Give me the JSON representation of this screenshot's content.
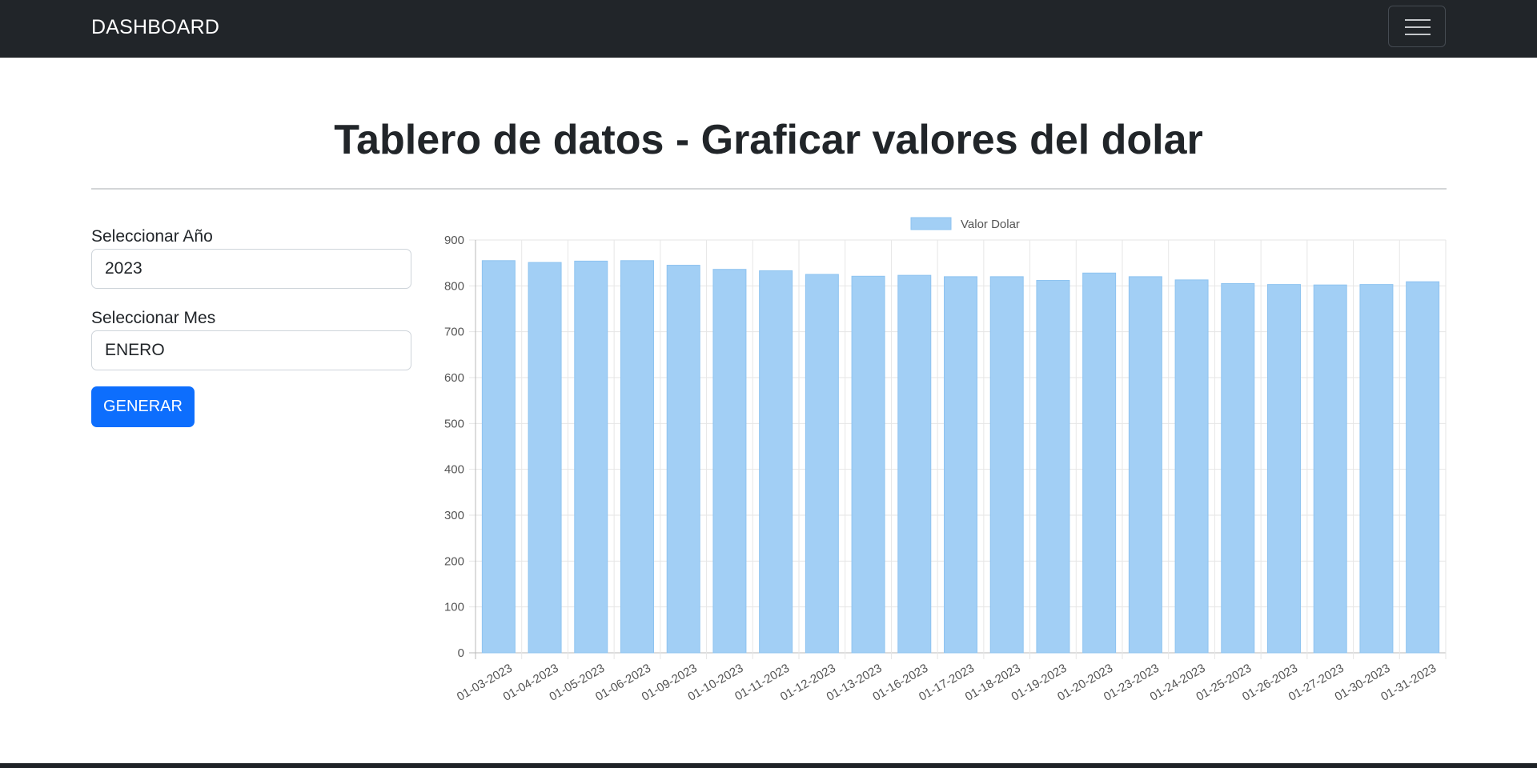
{
  "navbar": {
    "brand": "DASHBOARD",
    "menu_icon": "hamburger-menu-icon"
  },
  "page": {
    "title": "Tablero de datos - Graficar valores del dolar"
  },
  "form": {
    "year_label": "Seleccionar Año",
    "year_value": "2023",
    "month_label": "Seleccionar Mes",
    "month_value": "ENERO",
    "submit_label": "GENERAR"
  },
  "colors": {
    "navbar": "#212529",
    "primary": "#0d6efd",
    "bar_fill": "#a2cff5",
    "bar_stroke": "#8ec3f0"
  },
  "chart_data": {
    "type": "bar",
    "legend_position": "top",
    "grid": true,
    "ylim": [
      0,
      900
    ],
    "y_ticks": [
      "0",
      "100",
      "200",
      "300",
      "400",
      "500",
      "600",
      "700",
      "800",
      "900"
    ],
    "categories": [
      "01-03-2023",
      "01-04-2023",
      "01-05-2023",
      "01-06-2023",
      "01-09-2023",
      "01-10-2023",
      "01-11-2023",
      "01-12-2023",
      "01-13-2023",
      "01-16-2023",
      "01-17-2023",
      "01-18-2023",
      "01-19-2023",
      "01-20-2023",
      "01-23-2023",
      "01-24-2023",
      "01-25-2023",
      "01-26-2023",
      "01-27-2023",
      "01-30-2023",
      "01-31-2023"
    ],
    "series": [
      {
        "name": "Valor Dolar",
        "values": [
          855,
          851,
          854,
          855,
          845,
          836,
          833,
          825,
          821,
          823,
          820,
          820,
          812,
          828,
          820,
          813,
          805,
          803,
          802,
          803,
          809
        ]
      }
    ]
  }
}
